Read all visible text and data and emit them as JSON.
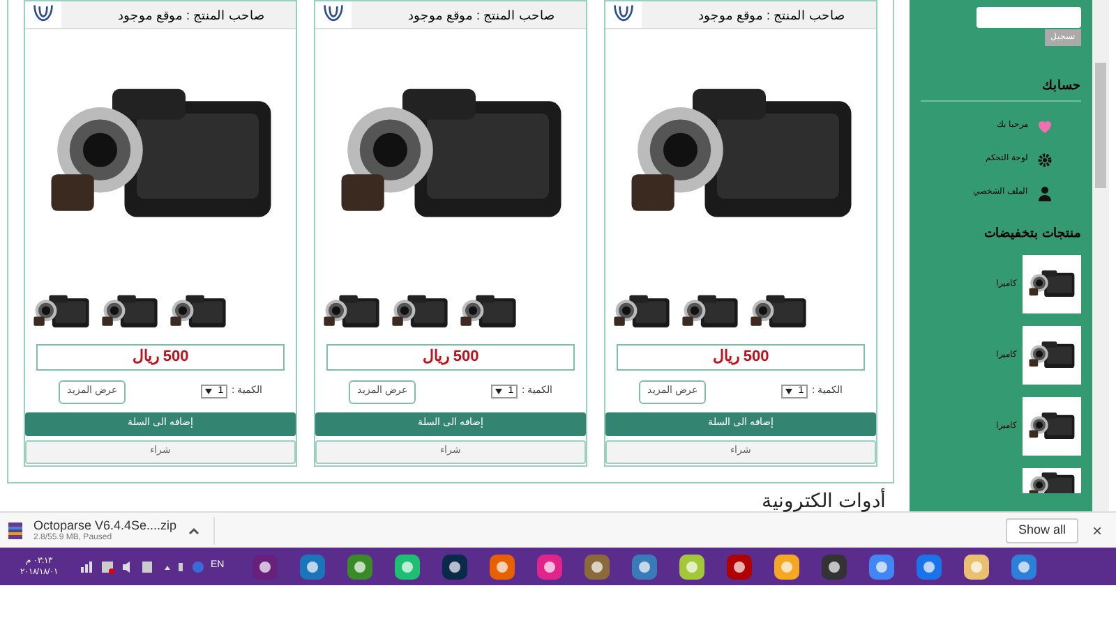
{
  "products": [
    {
      "owner": "صاحب المنتج : موقع موجود",
      "price": "500 ريال",
      "qty_label": "الكمية :",
      "qty": "1",
      "more": "عرض المزيد",
      "add_to_cart": "إضافه الى السلة",
      "buy": "شراء"
    },
    {
      "owner": "صاحب المنتج : موقع موجود",
      "price": "500 ريال",
      "qty_label": "الكمية :",
      "qty": "1",
      "more": "عرض المزيد",
      "add_to_cart": "إضافه الى السلة",
      "buy": "شراء"
    },
    {
      "owner": "صاحب المنتج : موقع موجود",
      "price": "500 ريال",
      "qty_label": "الكمية :",
      "qty": "1",
      "more": "عرض المزيد",
      "add_to_cart": "إضافه الى السلة",
      "buy": "شراء"
    }
  ],
  "section_heading": "أدوات الكترونية",
  "sidebar": {
    "login_button": "تسجيل",
    "account_heading": "حسابك",
    "account_items": [
      {
        "kind": "heart",
        "label": "مرحبا بك"
      },
      {
        "kind": "gear",
        "label": "لوحة التحكم"
      },
      {
        "kind": "user",
        "label": "الملف الشخصي"
      }
    ],
    "discount_heading": "منتجات بتخفيضات",
    "discount_items": [
      {
        "kind": "full",
        "label": "كاميرا"
      },
      {
        "kind": "full",
        "label": "كاميرا"
      },
      {
        "kind": "full",
        "label": "كاميرا"
      },
      {
        "kind": "partial"
      }
    ]
  },
  "download_bar": {
    "file": "Octoparse V6.4.4Se....zip",
    "status": "2.8/55.9 MB, Paused",
    "show_all": "Show all",
    "close": "×"
  },
  "taskbar": {
    "time": "٠٣:١٣ م",
    "date": "٢٠١٨/١٨/٠١",
    "language": "EN"
  }
}
